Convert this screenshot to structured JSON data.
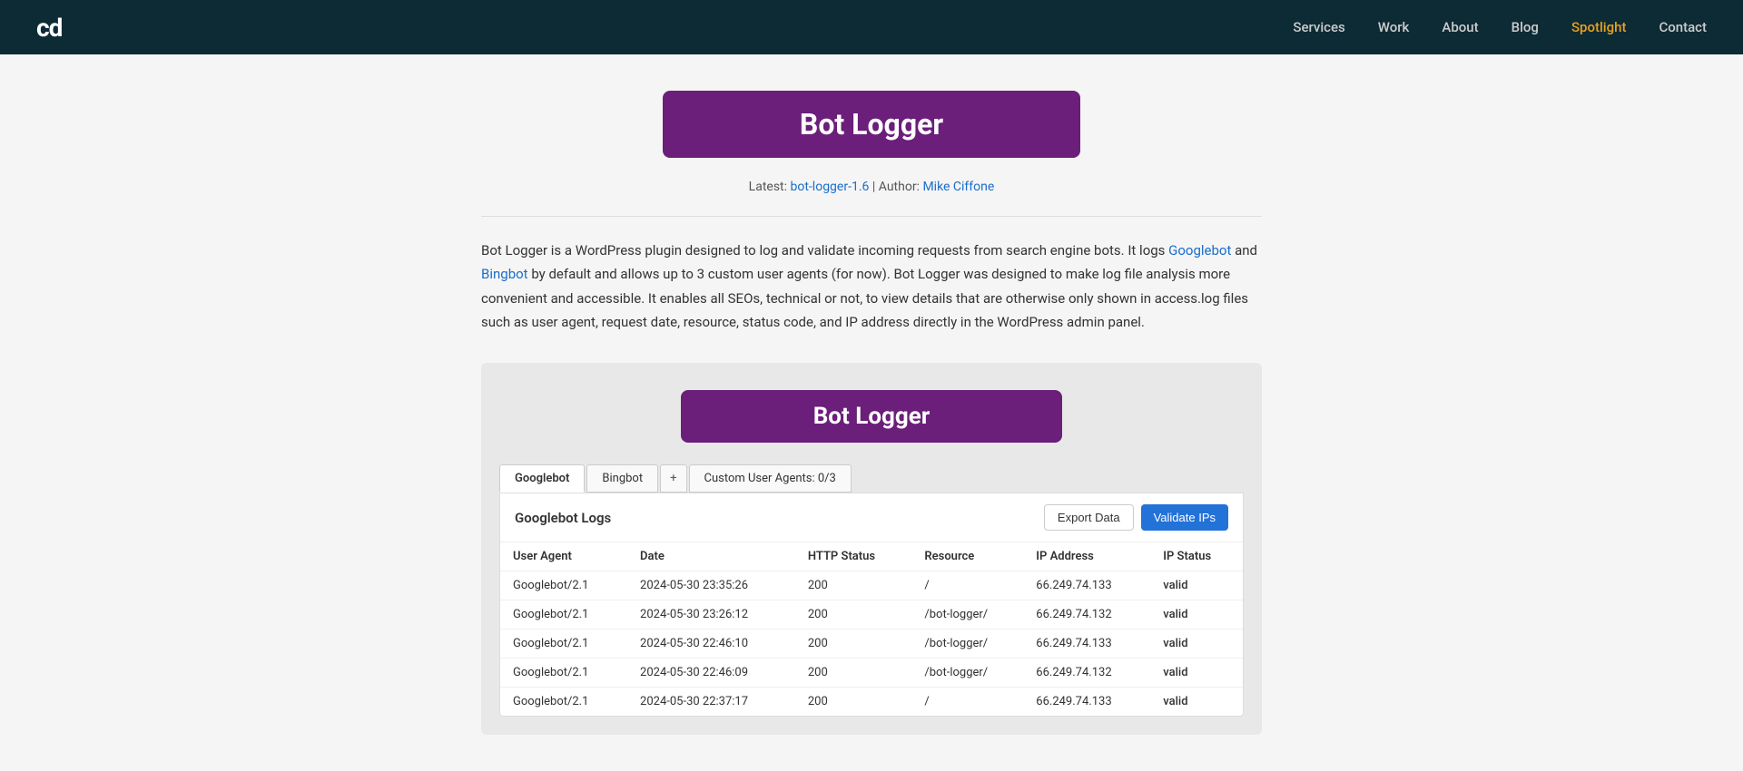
{
  "header": {
    "logo": "cd",
    "nav": [
      {
        "label": "Services",
        "href": "#",
        "class": ""
      },
      {
        "label": "Work",
        "href": "#",
        "class": ""
      },
      {
        "label": "About",
        "href": "#",
        "class": ""
      },
      {
        "label": "Blog",
        "href": "#",
        "class": ""
      },
      {
        "label": "Spotlight",
        "href": "#",
        "class": "spotlight"
      },
      {
        "label": "Contact",
        "href": "#",
        "class": ""
      }
    ]
  },
  "hero": {
    "title": "Bot Logger",
    "latest_label": "Latest:",
    "latest_link": "bot-logger-1.6",
    "author_label": "Author:",
    "author_link": "Mike Ciffone"
  },
  "description": {
    "text_1": "Bot Logger is a WordPress plugin designed to log and validate incoming requests from search engine bots. It logs ",
    "googlebot_link": "Googlebot",
    "text_2": " and ",
    "bingbot_link": "Bingbot",
    "text_3": " by default and allows up to 3 custom user agents (for now). Bot Logger was designed to make log file analysis more convenient and accessible. It enables all SEOs, technical or not, to view details that are otherwise only shown in access.log files such as user agent, request date, resource, status code, and IP address directly in the WordPress admin panel."
  },
  "preview": {
    "badge_title": "Bot Logger",
    "tabs": [
      {
        "label": "Googlebot",
        "active": true
      },
      {
        "label": "Bingbot",
        "active": false
      },
      {
        "label": "+",
        "type": "plus"
      },
      {
        "label": "Custom User Agents: 0/3",
        "active": false
      }
    ],
    "log_section": {
      "title": "Googlebot Logs",
      "export_btn": "Export Data",
      "validate_btn": "Validate IPs",
      "columns": [
        "User Agent",
        "Date",
        "HTTP Status",
        "Resource",
        "IP Address",
        "IP Status"
      ],
      "rows": [
        {
          "user_agent": "Googlebot/2.1",
          "date": "2024-05-30 23:35:26",
          "http_status": "200",
          "resource": "/",
          "ip_address": "66.249.74.133",
          "ip_status": "valid"
        },
        {
          "user_agent": "Googlebot/2.1",
          "date": "2024-05-30 23:26:12",
          "http_status": "200",
          "resource": "/bot-logger/",
          "ip_address": "66.249.74.132",
          "ip_status": "valid"
        },
        {
          "user_agent": "Googlebot/2.1",
          "date": "2024-05-30 22:46:10",
          "http_status": "200",
          "resource": "/bot-logger/",
          "ip_address": "66.249.74.133",
          "ip_status": "valid"
        },
        {
          "user_agent": "Googlebot/2.1",
          "date": "2024-05-30 22:46:09",
          "http_status": "200",
          "resource": "/bot-logger/",
          "ip_address": "66.249.74.132",
          "ip_status": "valid"
        },
        {
          "user_agent": "Googlebot/2.1",
          "date": "2024-05-30 22:37:17",
          "http_status": "200",
          "resource": "/",
          "ip_address": "66.249.74.133",
          "ip_status": "valid"
        }
      ]
    }
  }
}
